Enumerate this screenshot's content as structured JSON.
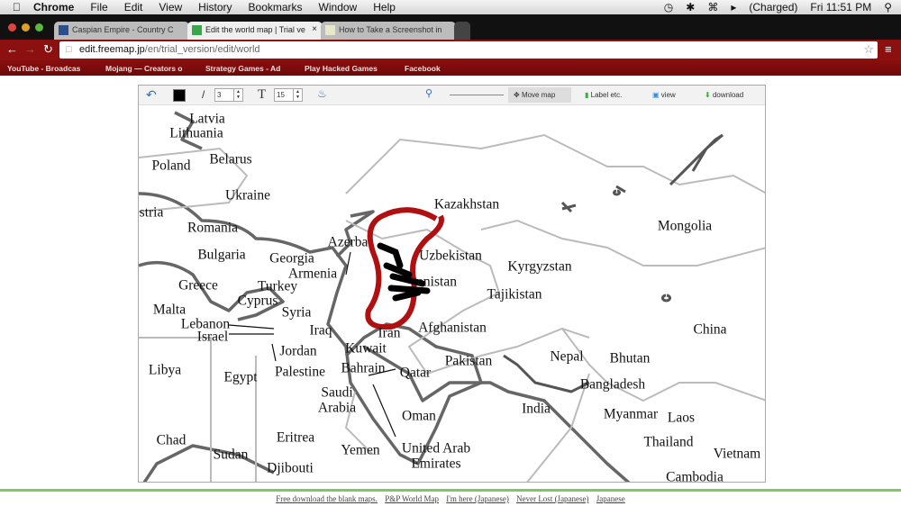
{
  "menubar": {
    "app": "Chrome",
    "items": [
      "File",
      "Edit",
      "View",
      "History",
      "Bookmarks",
      "Window",
      "Help"
    ],
    "battery": "(Charged)",
    "clock": "Fri 11:51 PM"
  },
  "tabs": [
    {
      "label": "Caspian Empire - Country C"
    },
    {
      "label": "Edit the world map | Trial ve"
    },
    {
      "label": "How to Take a Screenshot in"
    }
  ],
  "address": {
    "host": "edit.freemap.jp",
    "path": "/en/trial_version/edit/world"
  },
  "bookmarks": [
    "YouTube - Broadcas",
    "Mojang — Creators o",
    "Strategy Games - Ad",
    "Play Hacked Games",
    "Facebook"
  ],
  "toolbar": {
    "line_width": "3",
    "font_size": "15",
    "move_map": "Move map",
    "label": "Label etc.",
    "view": "view",
    "download": "download"
  },
  "map_labels": [
    "Latvia",
    "Lithuania",
    "Poland",
    "Belarus",
    "Ukraine",
    "stria",
    "Romania",
    "Bulgaria",
    "Georgia",
    "Azerba",
    "Armenia",
    "Turkey",
    "Greece",
    "Cyprus",
    "Syria",
    "Malta",
    "Lebanon",
    "Israel",
    "Iraq",
    "Jordan",
    "Kuwait",
    "Palestine",
    "Bahrain",
    "Qatar",
    "Libya",
    "Egypt",
    "Saudi",
    "Arabia",
    "Oman",
    "United Arab",
    "Emirates",
    "Yemen",
    "Eritrea",
    "Chad",
    "Sudan",
    "Djibouti",
    "Kazakhstan",
    "Uzbekistan",
    "enistan",
    "Iran",
    "Afghanistan",
    "Kyrgyzstan",
    "Tajikistan",
    "Pakistan",
    "Mongolia",
    "China",
    "Nepal",
    "Bhutan",
    "Bangladesh",
    "India",
    "Myanmar",
    "Laos",
    "Thailand",
    "Vietnam",
    "Cambodia"
  ],
  "footer": [
    "Free download the blank maps.",
    "P&P World Map",
    "I'm here (Japanese)",
    "Never Lost (Japanese)",
    "Japanese"
  ],
  "colors": {
    "scribble": "#b01010",
    "bookmark_bar": "#7a0c0c",
    "footer_line": "#7ec860"
  }
}
